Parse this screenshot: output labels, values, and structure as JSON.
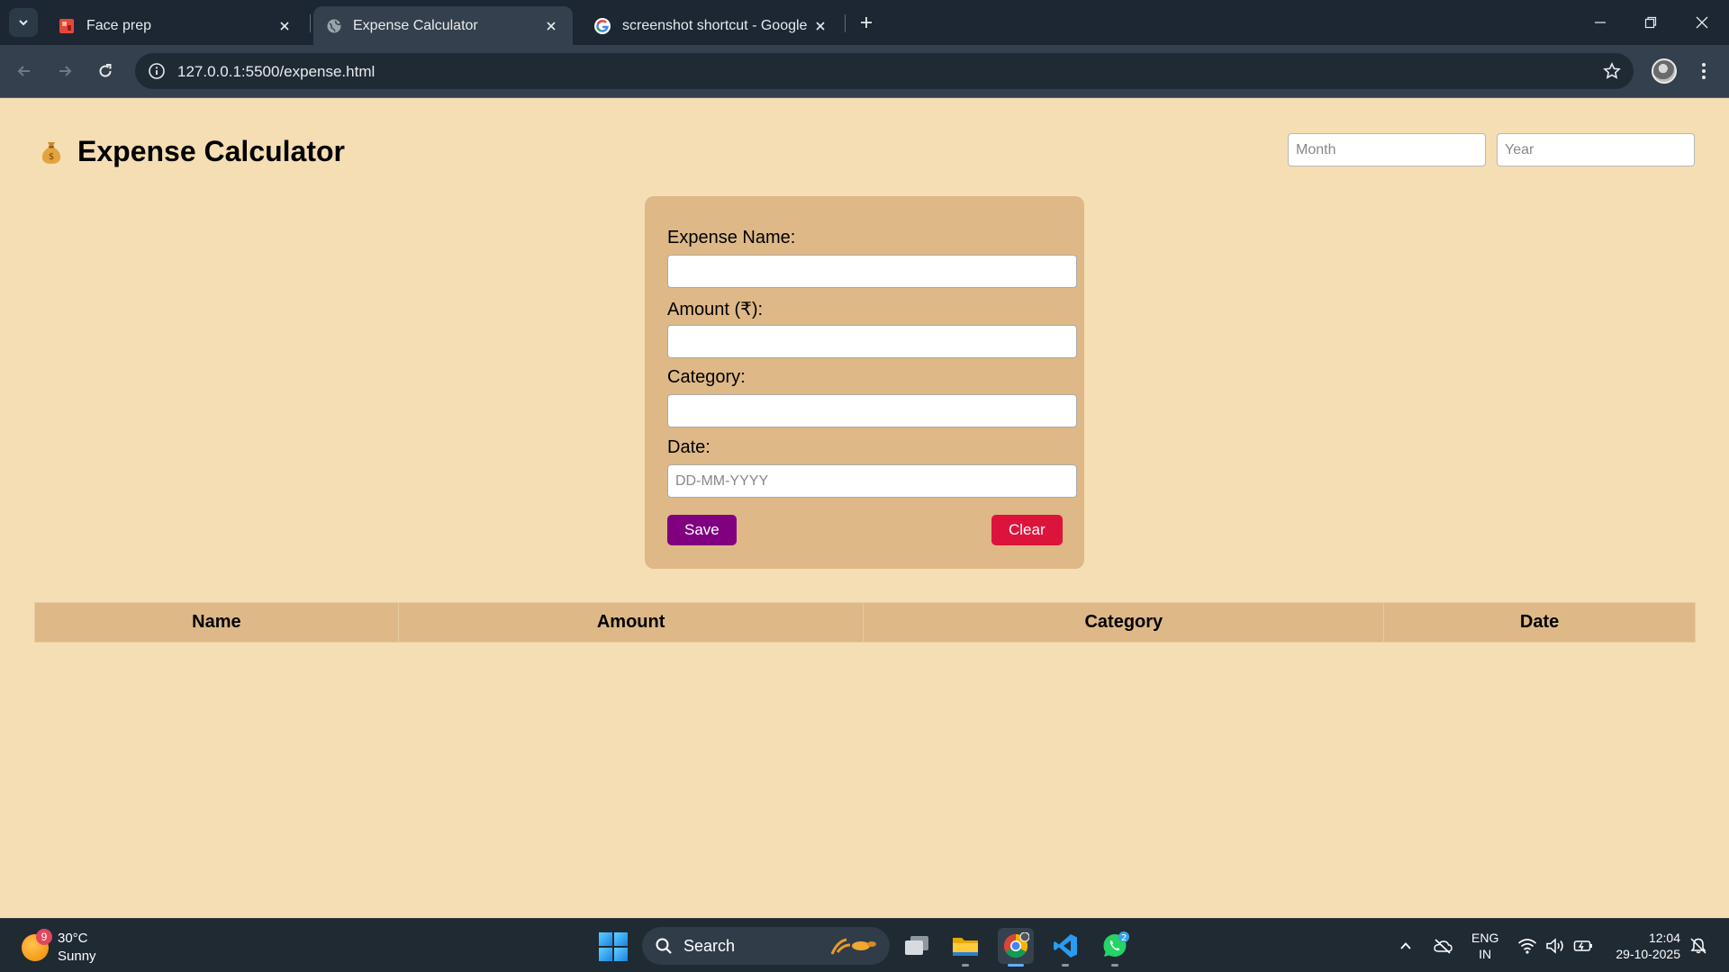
{
  "browser": {
    "tabs": [
      {
        "title": "Face prep"
      },
      {
        "title": "Expense Calculator"
      },
      {
        "title": "screenshot shortcut - Google Search"
      }
    ],
    "url": "127.0.0.1:5500/expense.html"
  },
  "page": {
    "title": "Expense Calculator",
    "title_icon": "money-bag-icon",
    "filters": {
      "month_placeholder": "Month",
      "year_placeholder": "Year"
    },
    "form": {
      "name_label": "Expense Name:",
      "amount_label": "Amount (₹):",
      "category_label": "Category:",
      "date_label": "Date:",
      "date_placeholder": "DD-MM-YYYY",
      "save_label": "Save",
      "clear_label": "Clear"
    },
    "table": {
      "headers": [
        "Name",
        "Amount",
        "Category",
        "Date"
      ]
    }
  },
  "taskbar": {
    "weather": {
      "temp": "30°C",
      "condition": "Sunny",
      "badge": "9"
    },
    "search_label": "Search",
    "whatsapp_badge": "2",
    "lang_line1": "ENG",
    "lang_line2": "IN",
    "time": "12:04",
    "date": "29-10-2025"
  },
  "colors": {
    "page_bg": "#f5deb3",
    "card_bg": "#deb887",
    "save_button": "#800080",
    "clear_button": "#dc143c"
  }
}
